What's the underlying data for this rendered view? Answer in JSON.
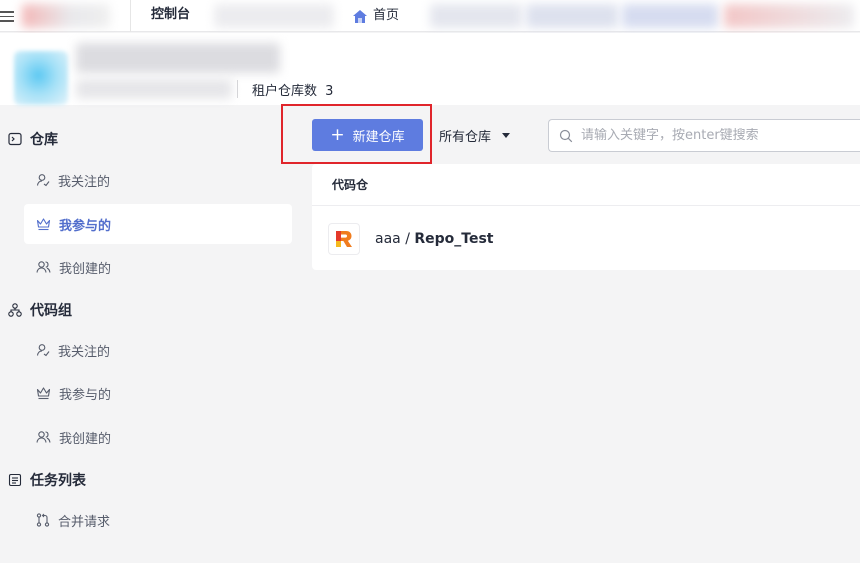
{
  "topbar": {
    "console_tab": "控制台",
    "home_tab": "首页"
  },
  "header": {
    "repo_count_label": "租户仓库数",
    "repo_count_value": "3"
  },
  "sidebar": {
    "repo_section": {
      "title": "仓库",
      "items": [
        {
          "label": "我关注的",
          "icon": "user-follow-icon",
          "active": false
        },
        {
          "label": "我参与的",
          "icon": "crown-icon",
          "active": true
        },
        {
          "label": "我创建的",
          "icon": "users-icon",
          "active": false
        }
      ]
    },
    "group_section": {
      "title": "代码组",
      "items": [
        {
          "label": "我关注的",
          "icon": "user-follow-icon"
        },
        {
          "label": "我参与的",
          "icon": "crown-icon"
        },
        {
          "label": "我创建的",
          "icon": "users-icon"
        }
      ]
    },
    "task_section": {
      "title": "任务列表",
      "items": [
        {
          "label": "合并请求",
          "icon": "merge-request-icon"
        }
      ]
    }
  },
  "toolbar": {
    "new_repo_label": "新建仓库",
    "filter_label": "所有仓库",
    "search_placeholder": "请输入关键字，按enter键搜索"
  },
  "list": {
    "column_header": "代码仓",
    "rows": [
      {
        "owner": "aaa",
        "separator": " / ",
        "name": "Repo_Test"
      }
    ]
  },
  "colors": {
    "primary": "#5e7ce0",
    "active_text": "#526ecc",
    "highlight_border": "#e0252b"
  }
}
